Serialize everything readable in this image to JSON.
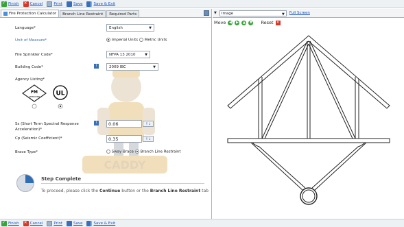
{
  "toolbar": {
    "finish": "Finish",
    "cancel": "Cancel",
    "print": "Print",
    "save": "Save",
    "save_exit": "Save & Exit"
  },
  "tabs": [
    {
      "label": "Fire Protection Calculator",
      "active": true
    },
    {
      "label": "Branch Line Restraint",
      "active": false
    },
    {
      "label": "Required Parts",
      "active": false
    }
  ],
  "form": {
    "language": {
      "label": "Language*",
      "value": "English"
    },
    "units": {
      "label": "Unit of Measure*",
      "option1": "Imperial Units",
      "option2": "Metric Units",
      "selected": "Imperial Units"
    },
    "sprinkler_code": {
      "label": "Fire Sprinkler Code*",
      "value": "NFPA 13 2010"
    },
    "building_code": {
      "label": "Building Code*",
      "value": "2009 IBC"
    },
    "agency": {
      "label": "Agency Listing*",
      "fm_text": "FM",
      "fm_sub": "APPROVED",
      "ul_text": "UL",
      "selected": "UL"
    },
    "ss": {
      "label_line1": "Ss (Short Term Spectral Response",
      "label_line2": "Acceleration)*",
      "value": "0.06"
    },
    "cp": {
      "label": "Cp (Seismic Coefficient)*",
      "value": "0.35"
    },
    "brace": {
      "label": "Brace Type*",
      "option1": "Sway Brace",
      "option2": "Branch Line Restraint",
      "selected": "Branch Line Restraint"
    }
  },
  "watermark": {
    "text": "CADDY"
  },
  "step": {
    "title": "Step Complete",
    "text_prefix": "To proceed, please click the",
    "continue_word": "Continue",
    "text_middle": "button or the",
    "tab_word": "Branch Line Restraint",
    "text_suffix": "tab",
    "progress": 0.25
  },
  "viewer": {
    "select_value": "Image",
    "full_screen": "Full Screen",
    "move_label": "Move",
    "reset_label": "Reset"
  },
  "colors": {
    "accent": "#3a6fb8",
    "link": "#1a56c4",
    "green": "#3aa33a",
    "red": "#d43a2a"
  }
}
